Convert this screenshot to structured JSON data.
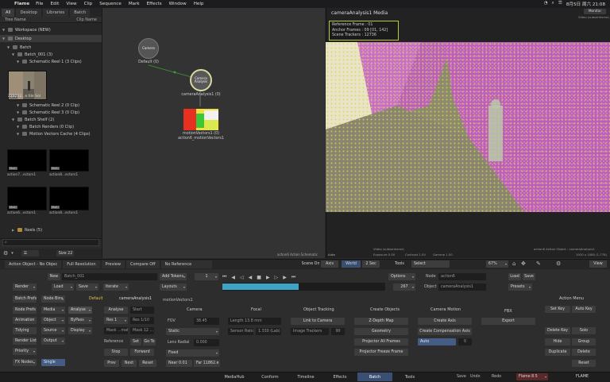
{
  "menubar": {
    "app": "Flame",
    "items": [
      "File",
      "Edit",
      "View",
      "Clip",
      "Sequence",
      "Mark",
      "Effects",
      "Window",
      "Help"
    ],
    "clock": "8月5日 周六 21:08"
  },
  "library": {
    "tabs": [
      "All",
      "Desktop",
      "Libraries",
      "Batch"
    ],
    "col_tree": "Tree Name",
    "col_clip": "Clip Name",
    "rows": [
      {
        "label": "Workspace (NEW)"
      },
      {
        "label": "Desktop"
      },
      {
        "label": "Batch"
      },
      {
        "label": "Batch_001 (3)"
      },
      {
        "label": "Schematic Reel 1 (3 Clips)"
      },
      {
        "label": "Schematic Reel 2 (0 Clip)"
      },
      {
        "label": "Schematic Reel 3 (0 Clip)"
      },
      {
        "label": "Batch Shelf (2)"
      },
      {
        "label": "Batch Renders (0 Clip)"
      },
      {
        "label": "Motion Vectors Cache (4 Clips)"
      },
      {
        "label": "Reels (5)"
      }
    ],
    "thumb_main": {
      "caption": "222222...e tile Sol",
      "badge": "60%"
    },
    "thumbs": [
      {
        "caption": "action7...ectors1",
        "badge": "Multi"
      },
      {
        "caption": "action8...ectors1",
        "badge": "Multi"
      },
      {
        "caption": "action6...ectors1",
        "badge": "Multi"
      },
      {
        "caption": "action8...ectors1",
        "badge": "Multi"
      }
    ],
    "footer_size": "Size 22"
  },
  "schematic": {
    "camera_node": "Camera",
    "camera_label": "Default (0)",
    "analysis_node": "Camera Analysis",
    "analysis_label": "cameraAnalysis1 (0)",
    "mv_label1": "motionVectors1 (0)",
    "mv_label2": "action6_motionVectors1",
    "footer": "action6 Action Schematic"
  },
  "viewer": {
    "title": "cameraAnalysis1 Media",
    "info": [
      "Reference Frame : 01",
      "Anchor Frames : 09 [01, 142]",
      "Scene Trackers : 12736"
    ],
    "monitor_label": "Monitor",
    "corner_top": "Video (subseriesme)",
    "footer_left": "Video (subseriesme)",
    "footer_mid1": "Exposure 0.00",
    "footer_mid2": "Contrast 1.00",
    "footer_mid3": "Gamma 1.00",
    "footer_right": "action6 Action Object : cameraAnalysis1",
    "res": "1920 x 1080 (1.778)",
    "left_tag": "Auto"
  },
  "bar1": {
    "items": [
      "Action Object - No Objec",
      "Full Resolution",
      "Preview",
      "Compare Off",
      "No Reference"
    ],
    "scene_on": "Scene On",
    "axis": "Axis",
    "world": "World",
    "zero": "2 Sec",
    "tools": "Tools",
    "select": "Select",
    "zoom": "67%",
    "view": "View"
  },
  "editor": {
    "new": "New",
    "batch_name": "Batch_001",
    "add_tokens": "Add Tokens",
    "render": "Render",
    "load": "Load",
    "save": "Save",
    "iterate": "Iterate",
    "layouts": "Layouts",
    "batch_prefs": "Batch Prefs",
    "node_bins": "Node Bins",
    "default": "Default",
    "camera_analysis": "cameraAnalysis1",
    "motion_vectors": "motionVectors1",
    "node_prefs": "Node Prefs",
    "media": "Media",
    "analyse": "Analyse",
    "animation": "Animation",
    "object": "Object",
    "bypass": "ByPass",
    "tidying": "Tidying",
    "source": "Source",
    "display": "Display",
    "render_list": "Render List",
    "output": "Output",
    "priority": "Priority",
    "fx_nodes": "FX Nodes",
    "single": "Single",
    "frame": "1",
    "frame_end": "267",
    "options": "Options",
    "node_label": "Node",
    "node_val": "action6",
    "object_label": "Object",
    "object_val": "cameraAnalysis1",
    "load_btn": "Load",
    "save_btn": "Save",
    "presets": "Presets",
    "analyse_btn": "Analyse",
    "start": "Start",
    "res1": "Res 1",
    "res_val": "Res 1/10",
    "mask": "Mask ...mate",
    "mask2": "Mask 12 ...",
    "reference": "Reference",
    "set": "Set",
    "goto": "Go To",
    "stop": "Stop",
    "forward": "Forward",
    "prev": "Prev",
    "next": "Next",
    "reset": "Reset",
    "camera_hdr": "Camera",
    "fov": "FOV",
    "fov_val": "38.45",
    "static": "Static",
    "lens": "Lens Radial",
    "lens_val": "0.000",
    "fixed": "Fixed",
    "near": "Near 0.01",
    "far": "Far 11862.e",
    "focal_hdr": "Focal",
    "focal_val": "Length 13.8 mm",
    "sensor": "Sensor Ratio",
    "sensor_val": "1.330 (Lab)",
    "tracking_hdr": "Object Tracking",
    "lnk_camera": "Link to Camera",
    "image_trackers": "Image Trackers",
    "trackers_val": "90",
    "create_hdr": "Create Objects",
    "depth_map": "Z-Depth Map",
    "geometry": "Geometry",
    "projector_frames": "Projector All Frames",
    "projector_frame": "Projector Freeze Frame",
    "motion_hdr": "Camera Motion",
    "create_axis": "Create Axis",
    "create_comp": "Create Compensation Axis",
    "auto": "Auto",
    "auto_val": "0",
    "fbx_hdr": "FBX",
    "export": "Export",
    "action_hdr": "Action Menu",
    "set_key": "Set Key",
    "auto_key": "Auto Key",
    "delete_key": "Delete Key",
    "solo": "Solo",
    "hide": "Hide",
    "group": "Group",
    "duplicate": "Duplicate",
    "delete": "Delete",
    "reset_btn": "Reset"
  },
  "bottom_tabs": [
    "MediaHub",
    "Conform",
    "Timeline",
    "Effects",
    "Batch",
    "Tools"
  ],
  "bottom_right": {
    "save": "Save",
    "undo": "Undo",
    "redo": "Redo",
    "project": "Flame 8.5",
    "brand": "FLAME"
  }
}
